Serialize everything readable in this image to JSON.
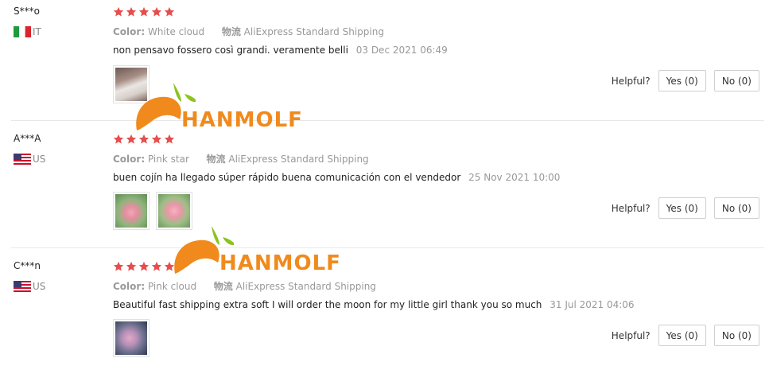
{
  "reviews": [
    {
      "user": "S***o",
      "country": "IT",
      "flag": "italy-flag-icon",
      "rating": 5,
      "color_label": "Color:",
      "color_value": "White cloud",
      "shipping_label": "物流",
      "shipping_value": "AliExpress Standard Shipping",
      "text": "non pensavo fossero così grandi. veramente belli",
      "date": "03 Dec 2021 06:49",
      "helpful_label": "Helpful?",
      "yes_label": "Yes (0)",
      "no_label": "No (0)"
    },
    {
      "user": "A***A",
      "country": "US",
      "flag": "us-flag-icon",
      "rating": 5,
      "color_label": "Color:",
      "color_value": "Pink star",
      "shipping_label": "物流",
      "shipping_value": "AliExpress Standard Shipping",
      "text": "buen cojín ha llegado súper rápido buena comunicación con el vendedor",
      "date": "25 Nov 2021 10:00",
      "helpful_label": "Helpful?",
      "yes_label": "Yes (0)",
      "no_label": "No (0)"
    },
    {
      "user": "C***n",
      "country": "US",
      "flag": "us-flag-icon",
      "rating": 5,
      "color_label": "Color:",
      "color_value": "Pink cloud",
      "shipping_label": "物流",
      "shipping_value": "AliExpress Standard Shipping",
      "text": "Beautiful fast shipping extra soft I will order the moon for my little girl thank you so much",
      "date": "31 Jul 2021 04:06",
      "helpful_label": "Helpful?",
      "yes_label": "Yes (0)",
      "no_label": "No (0)"
    }
  ],
  "watermark": {
    "text": "HANMOLF",
    "color": "#f08a1c",
    "leaf_color": "#8dc21f"
  },
  "colors": {
    "star": "#e64d4d",
    "muted": "#999999",
    "border": "#cfcfcf"
  }
}
